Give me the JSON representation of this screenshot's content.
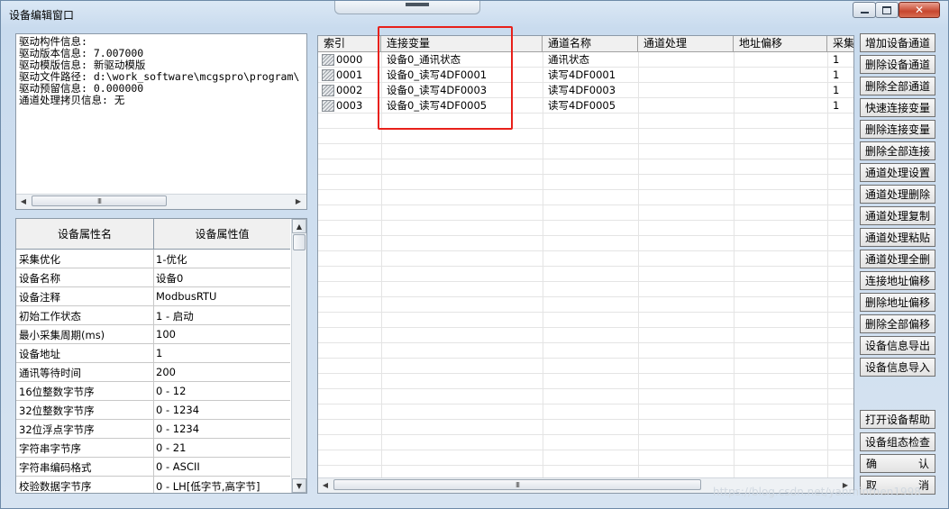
{
  "window": {
    "title": "设备编辑窗口",
    "close_glyph": "✕"
  },
  "info": {
    "lines": [
      "驱动构件信息:",
      "驱动版本信息: 7.007000",
      "驱动模版信息: 新驱动模版",
      "驱动文件路径: d:\\work_software\\mcgspro\\program\\",
      "驱动预留信息: 0.000000",
      "通道处理拷贝信息: 无"
    ]
  },
  "properties": {
    "header_name": "设备属性名",
    "header_value": "设备属性值",
    "rows": [
      {
        "name": "采集优化",
        "value": "1-优化"
      },
      {
        "name": "设备名称",
        "value": "设备0"
      },
      {
        "name": "设备注释",
        "value": "ModbusRTU"
      },
      {
        "name": "初始工作状态",
        "value": "1 - 启动"
      },
      {
        "name": "最小采集周期(ms)",
        "value": "100"
      },
      {
        "name": "设备地址",
        "value": "1"
      },
      {
        "name": "通讯等待时间",
        "value": "200"
      },
      {
        "name": "16位整数字节序",
        "value": "0 - 12"
      },
      {
        "name": "32位整数字节序",
        "value": "0 - 1234"
      },
      {
        "name": "32位浮点字节序",
        "value": "0 - 1234"
      },
      {
        "name": "字符串字节序",
        "value": "0 - 21"
      },
      {
        "name": "字符串编码格式",
        "value": "0 - ASCII"
      },
      {
        "name": "校验数据字节序",
        "value": "0 - LH[低字节,高字节]"
      }
    ]
  },
  "grid": {
    "columns": [
      "索引",
      "连接变量",
      "通道名称",
      "通道处理",
      "地址偏移",
      "采集"
    ],
    "rows": [
      {
        "index": "0000",
        "variable": "设备0_通讯状态",
        "channel": "通讯状态",
        "process": "",
        "offset": "",
        "collect": "1"
      },
      {
        "index": "0001",
        "variable": "设备0_读写4DF0001",
        "channel": "读写4DF0001",
        "process": "",
        "offset": "",
        "collect": "1"
      },
      {
        "index": "0002",
        "variable": "设备0_读写4DF0003",
        "channel": "读写4DF0003",
        "process": "",
        "offset": "",
        "collect": "1"
      },
      {
        "index": "0003",
        "variable": "设备0_读写4DF0005",
        "channel": "读写4DF0005",
        "process": "",
        "offset": "",
        "collect": "1"
      }
    ]
  },
  "buttons": {
    "add_channel": "增加设备通道",
    "delete_channel": "删除设备通道",
    "delete_all_channels": "删除全部通道",
    "quick_connect": "快速连接变量",
    "delete_connect": "删除连接变量",
    "delete_all_connect": "删除全部连接",
    "process_settings": "通道处理设置",
    "process_delete": "通道处理删除",
    "process_copy": "通道处理复制",
    "process_paste": "通道处理粘贴",
    "process_delete_all": "通道处理全删",
    "connect_offset": "连接地址偏移",
    "delete_offset": "删除地址偏移",
    "delete_all_offset": "删除全部偏移",
    "export_info": "设备信息导出",
    "import_info": "设备信息导入",
    "open_help": "打开设备帮助",
    "config_check": "设备组态检查",
    "ok_left": "确",
    "ok_right": "认",
    "cancel_left": "取",
    "cancel_right": "消"
  },
  "scroll_glyphs": {
    "left": "◀",
    "right": "▶",
    "up": "▲",
    "down": "▼",
    "grip": "III"
  },
  "watermark": "https://blog.csdn.net/yanminthen1998"
}
